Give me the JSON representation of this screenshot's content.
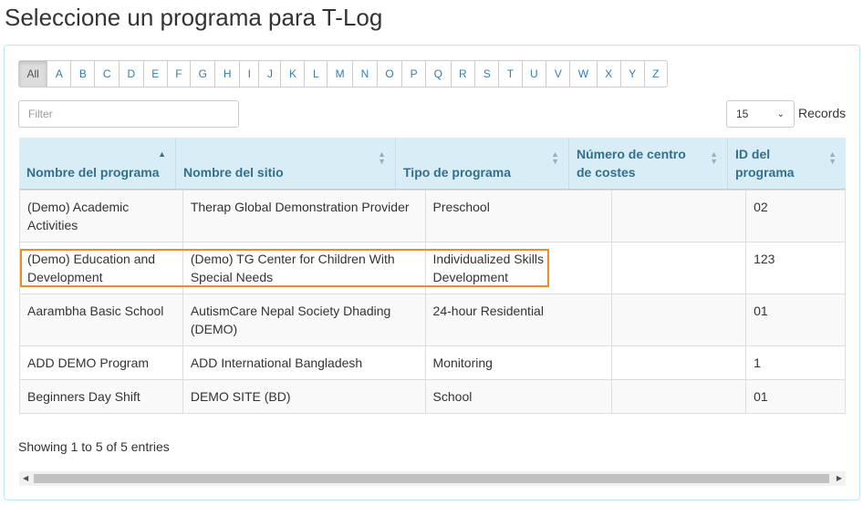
{
  "title": "Seleccione un programa para T-Log",
  "alphabet": [
    "All",
    "A",
    "B",
    "C",
    "D",
    "E",
    "F",
    "G",
    "H",
    "I",
    "J",
    "K",
    "L",
    "M",
    "N",
    "O",
    "P",
    "Q",
    "R",
    "S",
    "T",
    "U",
    "V",
    "W",
    "X",
    "Y",
    "Z"
  ],
  "filter": {
    "placeholder": "Filter",
    "value": ""
  },
  "records": {
    "selected": "15",
    "label": "Records"
  },
  "columns": [
    "Nombre del programa",
    "Nombre del sitio",
    "Tipo de programa",
    "Número de centro de costes",
    "ID del programa"
  ],
  "sort": {
    "column": "Nombre del programa",
    "direction": "ascending"
  },
  "rows": [
    [
      "(Demo) Academic Activities",
      "Therap Global Demonstration Provider",
      "Preschool",
      "",
      "02"
    ],
    [
      "(Demo) Education and Development",
      "(Demo) TG Center for Children With Special Needs",
      "Individualized Skills Development",
      "",
      "123"
    ],
    [
      "Aarambha Basic School",
      "AutismCare Nepal Society Dhading (DEMO)",
      "24-hour Residential",
      "",
      "01"
    ],
    [
      "ADD DEMO Program",
      "ADD International Bangladesh",
      "Monitoring",
      "",
      "1"
    ],
    [
      "Beginners Day Shift",
      "DEMO SITE (BD)",
      "School",
      "",
      "01"
    ]
  ],
  "highlighted_row": 1,
  "highlight_color": "#f08a24",
  "info": "Showing 1 to 5 of 5 entries"
}
